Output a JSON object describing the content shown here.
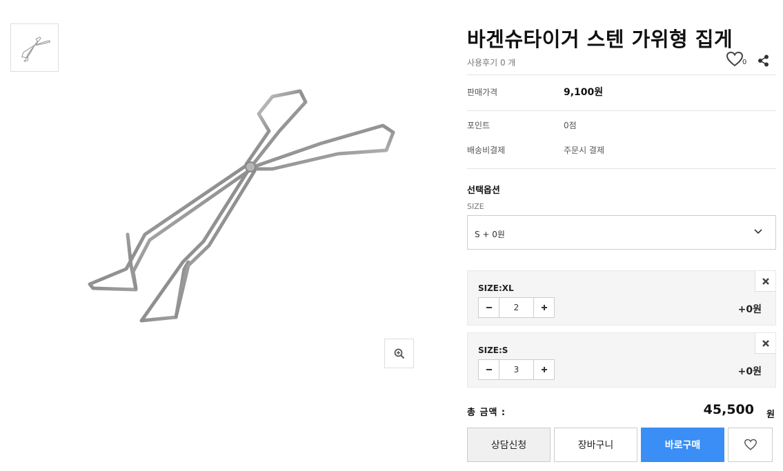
{
  "product": {
    "title": "바겐슈타이거 스텐 가위형 집게",
    "review_text": "사용후기 0 개",
    "like_count": "0",
    "image_icon": "tongs-image",
    "zoom_icon": "zoom-in-icon"
  },
  "info_rows": {
    "price": {
      "label": "판매가격",
      "value": "9,100원"
    },
    "point": {
      "label": "포인트",
      "value": "0점"
    },
    "shipping": {
      "label": "배송비결제",
      "value": "주문시 결제"
    }
  },
  "options": {
    "section_title": "선택옵션",
    "size_label": "SIZE",
    "selected_value": "S  + 0원",
    "items": [
      {
        "name": "SIZE:XL",
        "qty": "2",
        "price": "+0원"
      },
      {
        "name": "SIZE:S",
        "qty": "3",
        "price": "+0원"
      }
    ]
  },
  "total": {
    "label": "총 금액 :",
    "value": "45,500",
    "unit": "원"
  },
  "buttons": {
    "consult": "상담신청",
    "cart": "장바구니",
    "buy": "바로구매"
  },
  "colors": {
    "buy_button": "#3a8ef6",
    "border": "#cccccc",
    "option_bg": "#f5f5f5"
  }
}
